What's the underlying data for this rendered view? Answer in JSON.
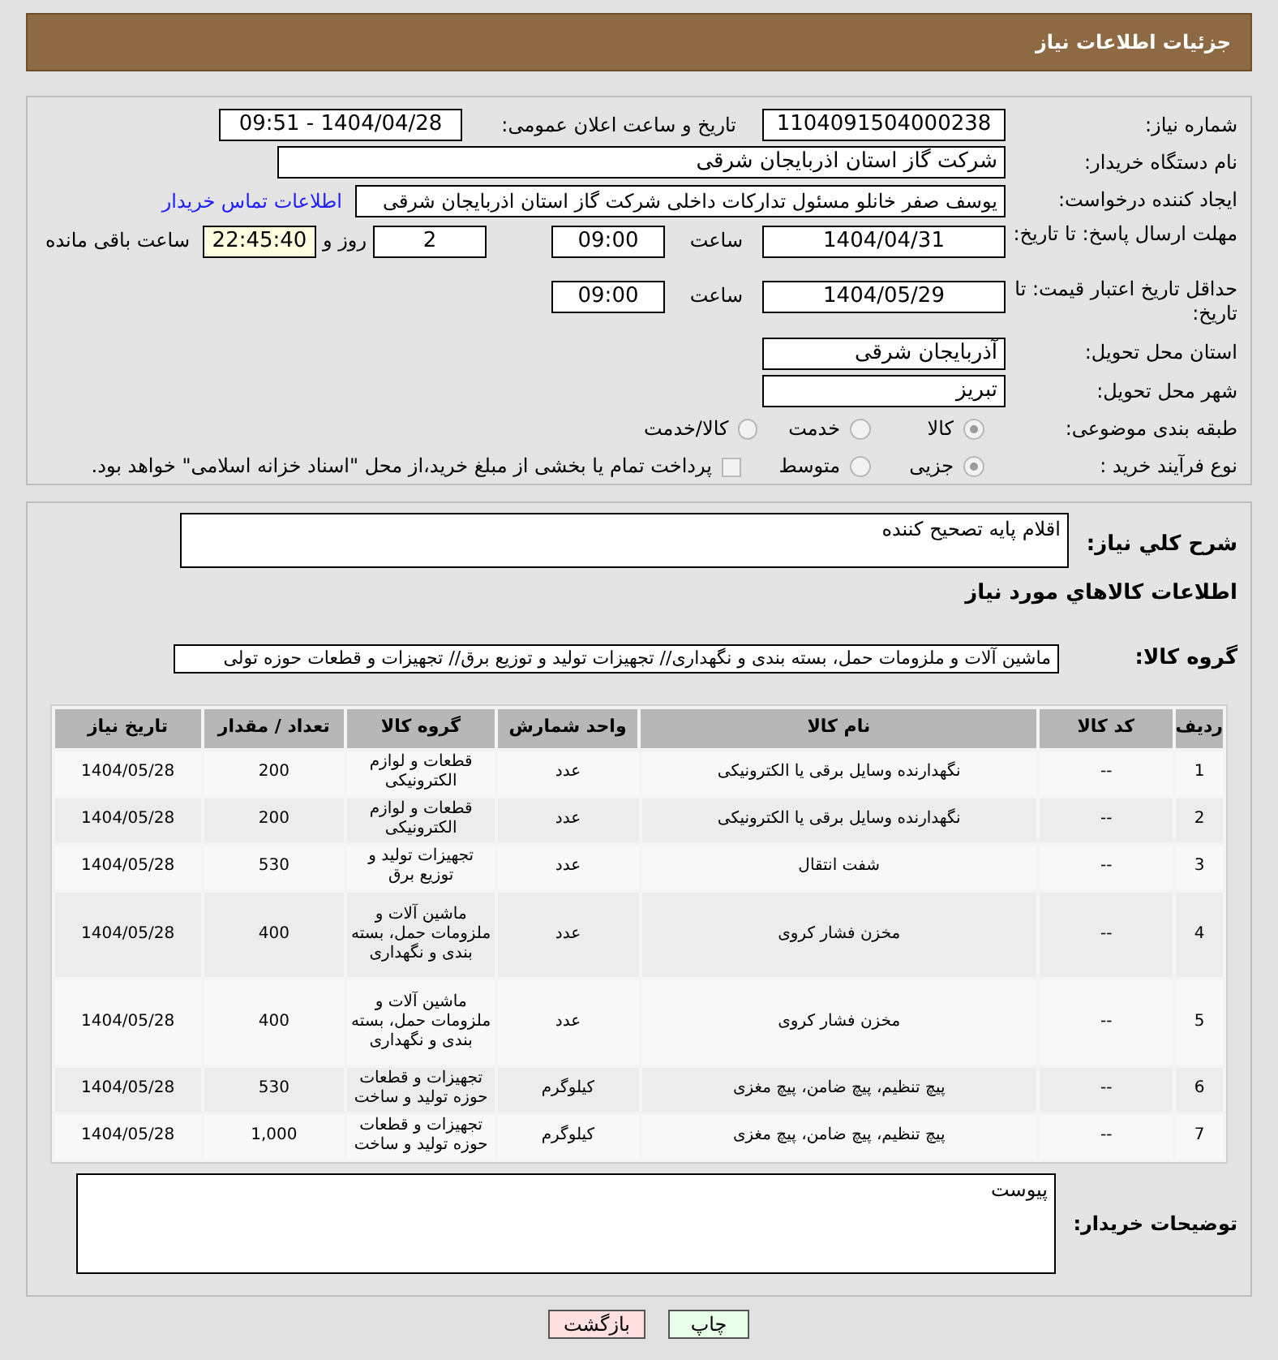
{
  "header": {
    "title": "جزئیات اطلاعات نیاز"
  },
  "form": {
    "need_number_label": "شماره نیاز:",
    "need_number": "1104091504000238",
    "announce_label": "تاریخ و ساعت اعلان عمومی:",
    "announce_value": "1404/04/28 - 09:51",
    "buyer_label": "نام دستگاه خریدار:",
    "buyer": "شرکت گاز استان اذربایجان شرقی",
    "requester_label": "ایجاد کننده درخواست:",
    "requester": "یوسف صفر خانلو  مسئول تدارکات داخلی  شرکت گاز استان اذربایجان شرقی",
    "contact_link": "اطلاعات تماس خریدار",
    "deadline_label": "مهلت ارسال پاسخ: تا تاریخ:",
    "deadline_date": "1404/04/31",
    "time_label": "ساعت",
    "deadline_time": "09:00",
    "days": "2",
    "days_label": "روز و",
    "remaining": "22:45:40",
    "remaining_label": "ساعت باقی مانده",
    "validity_label": "حداقل تاریخ اعتبار قیمت: تا تاریخ:",
    "validity_date": "1404/05/29",
    "validity_time_label": "ساعت",
    "validity_time": "09:00",
    "province_label": "استان محل تحویل:",
    "province": "آذربایجان شرقی",
    "city_label": "شهر محل تحویل:",
    "city": "تبریز",
    "category_label": "طبقه بندی موضوعی:",
    "categories": [
      {
        "label": "کالا",
        "selected": true
      },
      {
        "label": "خدمت",
        "selected": false
      },
      {
        "label": "کالا/خدمت",
        "selected": false
      }
    ],
    "process_label": "نوع فرآیند خرید :",
    "processes": [
      {
        "label": "جزیی",
        "selected": true
      },
      {
        "label": "متوسط",
        "selected": false
      }
    ],
    "payment": {
      "label": "پرداخت تمام یا بخشی از مبلغ خرید،از محل \"اسناد خزانه اسلامی\" خواهد بود.",
      "checked": false
    }
  },
  "description": {
    "label": "شرح كلي نياز:",
    "value": "اقلام پایه تصحیح کننده"
  },
  "goods_title": "اطلاعات كالاهاي مورد نياز",
  "goods_group": {
    "label": "گروه کالا:",
    "value": "ماشین آلات و ملزومات حمل، بسته بندی و نگهداری// تجهیزات تولید و توزیع برق// تجهیزات و قطعات حوزه تولی"
  },
  "table": {
    "columns": [
      "ردیف",
      "کد کالا",
      "نام کالا",
      "واحد شمارش",
      "گروه کالا",
      "تعداد / مقدار",
      "تاریخ نیاز"
    ],
    "rows": [
      [
        "1",
        "--",
        "نگهدارنده وسایل برقی یا الکترونیکی",
        "عدد",
        "قطعات و لوازم الکترونیکی",
        "200",
        "1404/05/28"
      ],
      [
        "2",
        "--",
        "نگهدارنده وسایل برقی یا الکترونیکی",
        "عدد",
        "قطعات و لوازم الکترونیکی",
        "200",
        "1404/05/28"
      ],
      [
        "3",
        "--",
        "شفت انتقال",
        "عدد",
        "تجهیزات تولید و توزیع برق",
        "530",
        "1404/05/28"
      ],
      [
        "4",
        "--",
        "مخزن فشار کروی",
        "عدد",
        "ماشین آلات و ملزومات حمل، بسته بندی و نگهداری",
        "400",
        "1404/05/28"
      ],
      [
        "5",
        "--",
        "مخزن فشار کروی",
        "عدد",
        "ماشین آلات و ملزومات حمل، بسته بندی و نگهداری",
        "400",
        "1404/05/28"
      ],
      [
        "6",
        "--",
        "پیچ تنظیم، پیچ ضامن، پیچ مغزی",
        "کیلوگرم",
        "تجهیزات و قطعات حوزه تولید و ساخت",
        "530",
        "1404/05/28"
      ],
      [
        "7",
        "--",
        "پیچ تنظیم، پیچ ضامن، پیچ مغزی",
        "کیلوگرم",
        "تجهیزات و قطعات حوزه تولید و ساخت",
        "1,000",
        "1404/05/28"
      ]
    ]
  },
  "buyer_notes": {
    "label": "توضیحات خریدار:",
    "value": "پیوست"
  },
  "buttons": [
    {
      "label": "چاپ",
      "kind": "print"
    },
    {
      "label": "بازگشت",
      "kind": "back"
    }
  ]
}
